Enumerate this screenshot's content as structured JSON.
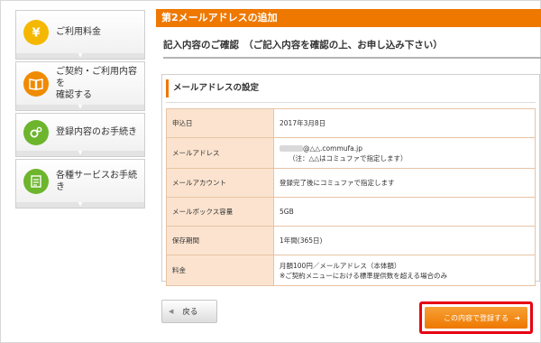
{
  "sidebar": {
    "items": [
      {
        "label": "ご利用料金",
        "icon": "yen-coin-icon"
      },
      {
        "label": "ご契約・ご利用内容を\n確認する",
        "icon": "book-icon"
      },
      {
        "label": "登録内容のお手続き",
        "icon": "gear-icon"
      },
      {
        "label": "各種サービスお手続き",
        "icon": "checklist-icon"
      }
    ]
  },
  "page": {
    "title": "第2メールアドレスの追加",
    "confirm_heading": "記入内容のご確認　（ご記入内容を確認の上、お申し込み下さい）",
    "section_heading": "メールアドレスの設定"
  },
  "table": {
    "rows": [
      {
        "label": "申込日",
        "value": "2017年3月8日",
        "value2": ""
      },
      {
        "label": "メールアドレス",
        "value": "@△△.commufa.jp",
        "value2": "（注：△△はコミュファで指定します）"
      },
      {
        "label": "メールアカウント",
        "value": "登録完了後にコミュファで指定します",
        "value2": ""
      },
      {
        "label": "メールボックス容量",
        "value": "5GB",
        "value2": ""
      },
      {
        "label": "保存期間",
        "value": "1年間(365日)",
        "value2": ""
      },
      {
        "label": "料金",
        "value": "月額100円／メールアドレス（本体額）",
        "value2": "※ご契約メニューにおける標準提供数を超える場合のみ"
      }
    ]
  },
  "buttons": {
    "back": "戻る",
    "submit": "この内容で登録する"
  },
  "colors": {
    "accent": "#ee7800",
    "highlight": "#e60012",
    "label_bg": "#fbe3cf"
  }
}
